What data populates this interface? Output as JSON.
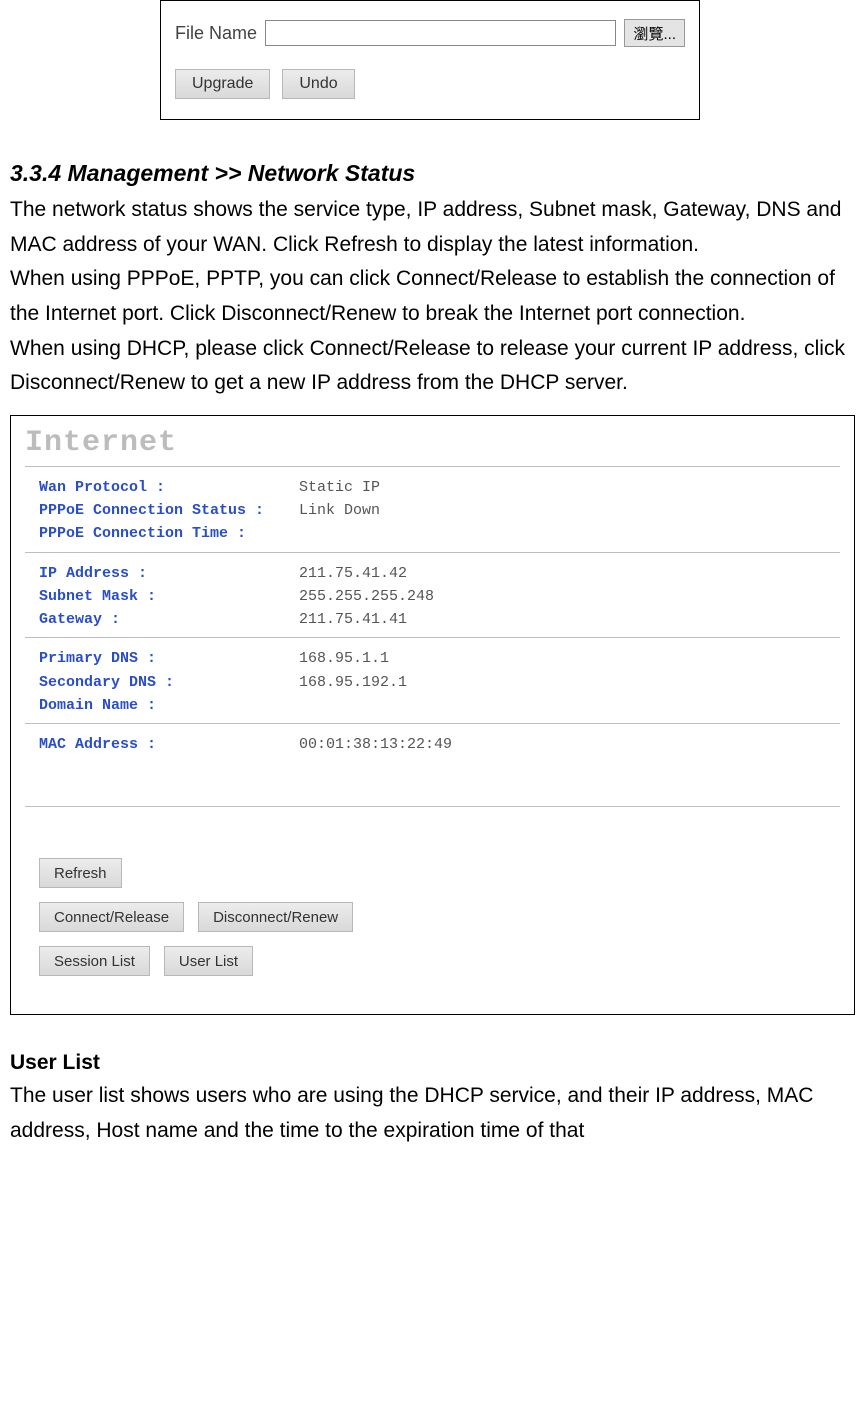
{
  "upload_panel": {
    "file_label": "File Name",
    "browse_label": "瀏覽...",
    "upgrade_label": "Upgrade",
    "undo_label": "Undo"
  },
  "section": {
    "heading": "3.3.4 Management >> Network Status",
    "para1": "The network status shows the service type, IP address, Subnet mask, Gateway, DNS and MAC address of your WAN. Click Refresh to display the latest information.",
    "para2": "When using PPPoE, PPTP, you can click Connect/Release to establish the connection of the Internet port. Click Disconnect/Renew to break the Internet port connection.",
    "para3": "When using DHCP, please click Connect/Release to release your current IP address, click Disconnect/Renew to get a new IP address from the DHCP server."
  },
  "status_panel": {
    "title": "Internet",
    "group1": [
      {
        "label": "Wan Protocol :",
        "value": "Static IP"
      },
      {
        "label": "PPPoE Connection Status :",
        "value": "Link Down"
      },
      {
        "label": "PPPoE Connection Time :",
        "value": ""
      }
    ],
    "group2": [
      {
        "label": "IP Address :",
        "value": "211.75.41.42"
      },
      {
        "label": "Subnet Mask :",
        "value": "255.255.255.248"
      },
      {
        "label": "Gateway :",
        "value": "211.75.41.41"
      }
    ],
    "group3": [
      {
        "label": "Primary DNS :",
        "value": "168.95.1.1"
      },
      {
        "label": "Secondary DNS :",
        "value": "168.95.192.1"
      },
      {
        "label": "Domain Name :",
        "value": ""
      }
    ],
    "group4": [
      {
        "label": "MAC Address :",
        "value": "00:01:38:13:22:49"
      }
    ],
    "buttons": {
      "refresh": "Refresh",
      "connect": "Connect/Release",
      "disconnect": "Disconnect/Renew",
      "session_list": "Session List",
      "user_list": "User List"
    }
  },
  "userlist": {
    "heading": "User List",
    "para": "The user list shows users who are using the DHCP service, and their IP address, MAC address, Host name and the time to the expiration time of that"
  }
}
